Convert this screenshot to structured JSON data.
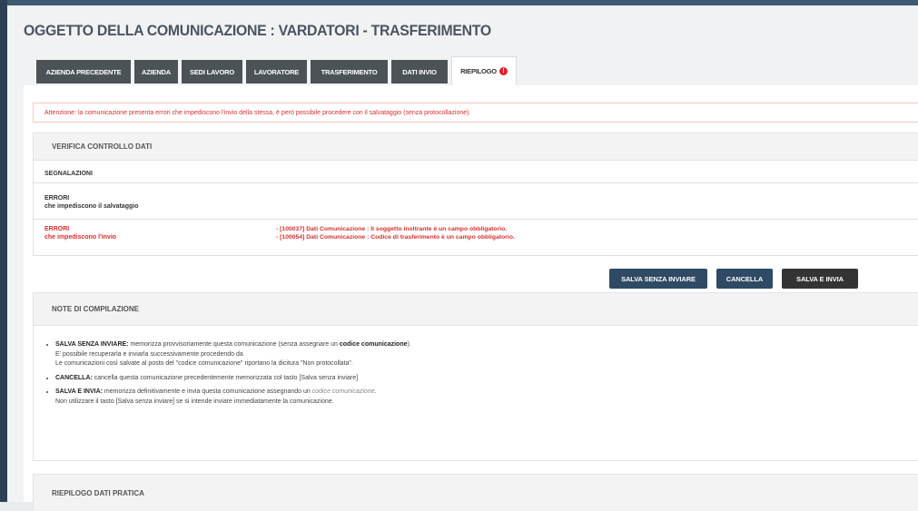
{
  "title": "OGGETTO DELLA COMUNICAZIONE : VARDATORI - TRASFERIMENTO",
  "tabs": [
    {
      "label": "AZIENDA PRECEDENTE"
    },
    {
      "label": "AZIENDA"
    },
    {
      "label": "SEDI LAVORO"
    },
    {
      "label": "LAVORATORE"
    },
    {
      "label": "TRASFERIMENTO"
    },
    {
      "label": "DATI INVIO"
    },
    {
      "label": "RIEPILOGO",
      "alert_icon": "!"
    }
  ],
  "alert_message": "Attenzione: la comunicazione presenta errori che impediscono l'invio della stessa, è però possibile procedere con il salvataggio (senza protocollazione).",
  "verify": {
    "header": "VERIFICA CONTROLLO DATI",
    "signals_label": "SEGNALAZIONI",
    "errors_save_title": "ERRORI",
    "errors_save_sub": "che impediscono il salvataggio",
    "errors_send_title": "ERRORI",
    "errors_send_sub": "che impediscono l'invio",
    "errors_send_messages": [
      "- [100037] Dati Comunicazione : Il soggetto inoltrante è un campo obbligatorio.",
      "- [100054] Dati Comunicazione : Codice di trasferimento è un campo obbligatorio."
    ]
  },
  "buttons": {
    "save_no_send": "SALVA SENZA INVIARE",
    "cancel": "CANCELLA",
    "save_send": "SALVA E INVIA"
  },
  "notes": {
    "header": "NOTE DI COMPILAZIONE",
    "item1_bold": "SALVA SENZA INVIARE:",
    "item1_text": " memorizza provvisoriamente questa comunicazione (senza assegnare un ",
    "item1_code": "codice comunicazione",
    "item1_end": ").",
    "item1_line2": "E' possibile recuperarla e inviarla successivamente procedendo da",
    "item1_line3": "Le comunicazioni così salvate al posto del \"codice comunicazione\" riportano la dicitura \"Non protocollata\".",
    "item2_bold": "CANCELLA:",
    "item2_text": " cancella questa comunicazione precedentemente memorizzata col tasto [Salva senza inviare]",
    "item3_bold": "SALVA E INVIA:",
    "item3_text": " memorizza definitivamente e invia questa comunicazione assegnando un ",
    "item3_code": "codice comunicazione",
    "item3_end": ".",
    "item3_line2": "Non utilizzare il tasto [Salva senza inviare] se si intende inviare immediatamente la comunicazione."
  },
  "summary_header": "RIEPILOGO DATI PRATICA",
  "icons": {
    "notch": "caret-down-icon",
    "tab_alert": "error-circle-icon"
  },
  "colors": {
    "accent": "#2f4a64",
    "error": "#d52f2f",
    "tab": "#4c5357"
  }
}
